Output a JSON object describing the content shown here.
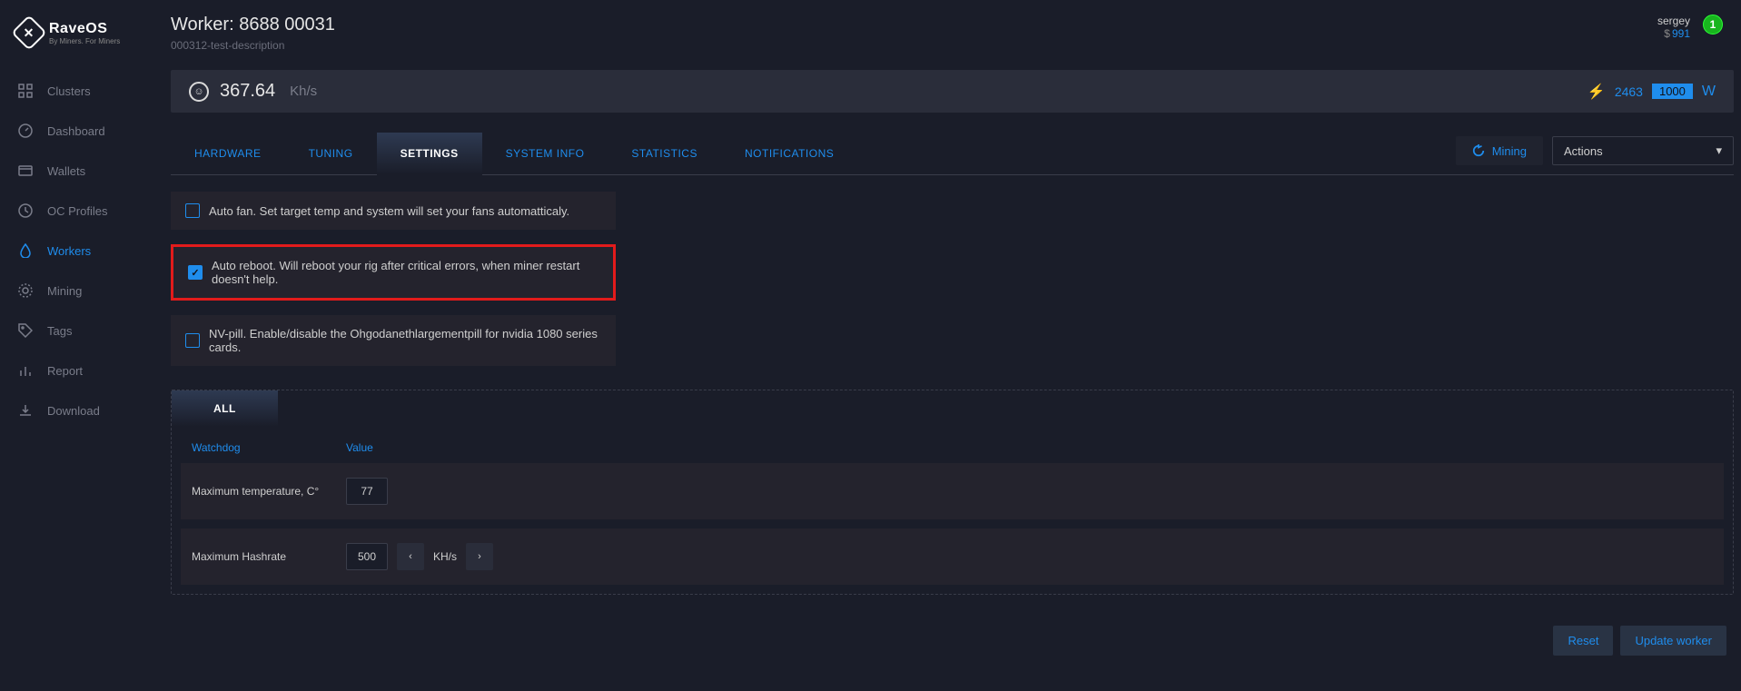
{
  "brand": {
    "name": "RaveOS",
    "tag": "By Miners. For Miners"
  },
  "nav": {
    "clusters": "Clusters",
    "dashboard": "Dashboard",
    "wallets": "Wallets",
    "oc_profiles": "OC Profiles",
    "workers": "Workers",
    "mining": "Mining",
    "tags": "Tags",
    "report": "Report",
    "download": "Download"
  },
  "header": {
    "title": "Worker: 8688 00031",
    "description": "000312-test-description",
    "user": "sergey",
    "balance": "991",
    "badge": "1"
  },
  "stats": {
    "hashrate": "367.64",
    "hash_unit": "Kh/s",
    "power1": "2463",
    "power2": "1000",
    "watt_label": "W"
  },
  "tabs": {
    "hardware": "HARDWARE",
    "tuning": "TUNING",
    "settings": "SETTINGS",
    "system_info": "SYSTEM INFO",
    "statistics": "STATISTICS",
    "notifications": "NOTIFICATIONS"
  },
  "right_controls": {
    "mining": "Mining",
    "actions": "Actions"
  },
  "settings": {
    "auto_fan": "Auto fan.  Set target temp and system will set your fans automatticaly.",
    "auto_reboot": "Auto reboot. Will reboot your rig after critical errors, when miner restart doesn't help.",
    "nv_pill": "NV-pill. Enable/disable the Ohgodanethlargementpill for nvidia 1080 series cards."
  },
  "watchdog": {
    "tab_all": "ALL",
    "col_watchdog": "Watchdog",
    "col_value": "Value",
    "row1_label": "Maximum temperature, C°",
    "row1_value": "77",
    "row2_label": "Maximum Hashrate",
    "row2_value": "500",
    "row2_unit": "KH/s"
  },
  "footer": {
    "reset": "Reset",
    "update": "Update worker"
  }
}
